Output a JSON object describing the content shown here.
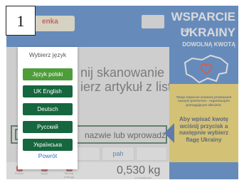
{
  "step_number": "1",
  "brand": {
    "logo_text": "enka"
  },
  "main": {
    "hint_line1": "nij skanowanie",
    "hint_line2": "ierz artykuł z listy",
    "search_placeholder": "nazwie lub wprowadź kod"
  },
  "partners": [
    "pah"
  ],
  "bottom_nav": [
    {
      "label": "Pomoc",
      "icon": "person-icon"
    },
    {
      "label": "Język",
      "icon": "flag-icon"
    },
    {
      "label": "Wezwij obsługę",
      "icon": "bell-icon"
    }
  ],
  "scale": {
    "weight": "0,530 kg",
    "sub": "e=d=0,002kg Max"
  },
  "donation": {
    "title1": "WSPARCIE",
    "title2": "DLA",
    "title3": "UKRAINY",
    "title4": "DOWOLNĄ KWOTĄ",
    "small_text": "Twoje wsparcie zostanie przekazane naszym partnerom - organizacjom pomagającym Ukrainie.",
    "big_text": "Aby wpisać kwotę wciśnij przycisk a następnie wybierz flagę Ukrainy"
  },
  "language_popup": {
    "title": "Wybierz język",
    "options": [
      {
        "label": "Język polski",
        "selected": true
      },
      {
        "label": "UK English",
        "selected": false
      },
      {
        "label": "Deutsch",
        "selected": false
      },
      {
        "label": "Русский",
        "selected": false
      },
      {
        "label": "Українська",
        "selected": false
      }
    ],
    "back_label": "Powrót"
  },
  "colors": {
    "selected": "#4f9d3a",
    "option": "#16663e",
    "brand_blue": "#2f72c9",
    "ukraine_yellow": "#f4d44a"
  }
}
